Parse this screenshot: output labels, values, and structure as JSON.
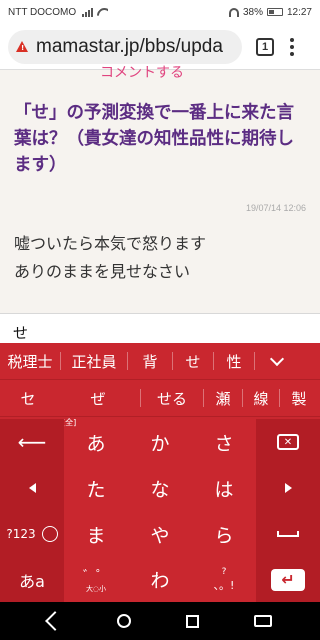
{
  "status_bar": {
    "carrier": "NTT DOCOMO",
    "battery": "38%",
    "time": "12:27"
  },
  "browser": {
    "url": "mamastar.jp/bbs/upda",
    "tab_count": "1"
  },
  "page": {
    "clipped_heading": "コメントする",
    "title": "「せ」の予測変換で一番上に来た言葉は？（貴女達の知性品性に期待します）",
    "date": "19/07/14 12:06",
    "body_lines": [
      "嘘ついたら本気で怒ります",
      "ありのままを見せなさい"
    ]
  },
  "input": {
    "value": "せ"
  },
  "keyboard": {
    "candidates_row1": [
      "税理士",
      "正社員",
      "背",
      "せ",
      "性"
    ],
    "candidates_row2": [
      "セ",
      "ぜ",
      "せる",
      "瀬",
      "線",
      "製"
    ],
    "width_toggle": "[全]",
    "kana_rows": [
      [
        "あ",
        "か",
        "さ"
      ],
      [
        "た",
        "な",
        "は"
      ],
      [
        "ま",
        "や",
        "ら"
      ],
      [
        "",
        "わ",
        ""
      ]
    ],
    "num_key": "?123",
    "mode_key": "あa",
    "dakuten_key": "゛゜",
    "small_label": "大◌小",
    "punct_top": "?",
    "punct_bottom": "、。!",
    "colors": {
      "accent": "#c9272f",
      "side_keys": "#b21d25",
      "title_purple": "#5c2d83"
    },
    "icons": [
      "undo-arrow-icon",
      "backspace-icon",
      "left-arrow-icon",
      "right-arrow-icon",
      "emoji-icon",
      "space-icon",
      "enter-icon",
      "chevron-down-icon"
    ]
  },
  "navbar": {
    "icons": [
      "back-icon",
      "home-icon",
      "recents-icon",
      "keyboard-icon"
    ]
  }
}
